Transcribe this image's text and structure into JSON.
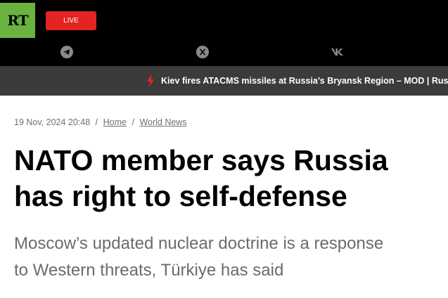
{
  "header": {
    "logo_text": "RT",
    "live_label": "LIVE",
    "social": [
      "telegram-icon",
      "x-icon",
      "vk-icon"
    ]
  },
  "ticker": {
    "text": "Kiev fires ATACMS missiles at Russia’s Bryansk Region – MOD | Rus"
  },
  "article": {
    "datetime": "19 Nov, 2024 20:48",
    "breadcrumb": [
      "Home",
      "World News"
    ],
    "headline_line1": "NATO member says Russia",
    "headline_line2": "has right to self-defense",
    "subtitle_line1": "Moscow’s updated nuclear doctrine is a response",
    "subtitle_line2": "to Western threats, Türkiye has said"
  },
  "colors": {
    "logo_bg": "#6bb33f",
    "live_bg": "#e42421",
    "ticker_bg": "#3b3b3b",
    "bolt": "#e42421"
  }
}
